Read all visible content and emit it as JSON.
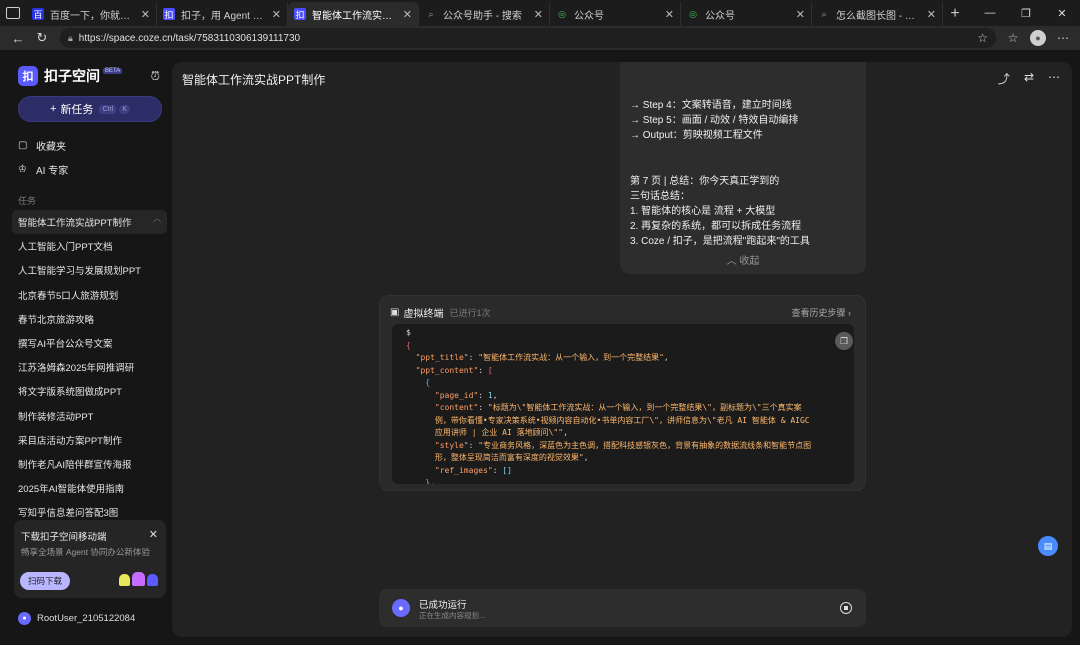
{
  "browser": {
    "tabs": [
      {
        "label": "百度一下，你就知道",
        "icon": "baidu-icon"
      },
      {
        "label": "扣子，用 Agent 重塑生产力",
        "icon": "coze-icon"
      },
      {
        "label": "智能体工作流实战PPT制作 ·",
        "icon": "coze-icon",
        "active": true
      },
      {
        "label": "公众号助手 - 搜索",
        "icon": "search-icon"
      },
      {
        "label": "公众号",
        "icon": "wechat-icon"
      },
      {
        "label": "公众号",
        "icon": "wechat-icon"
      },
      {
        "label": "怎么截图长图 - 搜索",
        "icon": "search-icon"
      }
    ],
    "url": "https://space.coze.cn/task/7583110306139111730"
  },
  "sidebar": {
    "brand": "扣子空间",
    "beta": "BETA",
    "new_task": "新任务",
    "favorites": "收藏夹",
    "ai_expert": "AI 专家",
    "section_tasks": "任务",
    "tasks": [
      "智能体工作流实战PPT制作",
      "人工智能入门PPT文档",
      "人工智能学习与发展规划PPT",
      "北京春节5口人旅游规划",
      "春节北京旅游攻略",
      "撰写AI平台公众号文案",
      "江苏洛姆森2025年网推调研",
      "将文字版系统图做成PPT",
      "制作装修活动PPT",
      "采目店活动方案PPT制作",
      "制作老凡AI陪伴群宣传海报",
      "2025年AI智能体使用指南",
      "写知乎信息差问答配3图"
    ],
    "promo": {
      "title": "下载扣子空间移动端",
      "subtitle": "畅享全场景 Agent 协同办公新体验",
      "button": "扫码下载"
    },
    "user": "RootUser_2105122084"
  },
  "main": {
    "title": "智能体工作流实战PPT制作",
    "message_lines": [
      "→ Step 4：文案转语音，建立时间线",
      "→ Step 5：画面 / 动效 / 特效自动编排",
      "→ Output：剪映视频工程文件",
      "",
      "第 7 页 | 总结：你今天真正学到的",
      "三句话总结：",
      "1. 智能体的核心是 流程 + 大模型",
      "2. 再复杂的系统，都可以拆成任务流程",
      "3. Coze / 扣子，是把流程\"跑起来\"的工具"
    ],
    "collapse": "收起",
    "terminal": {
      "title": "虚拟终端",
      "count": "已进行1次",
      "history": "查看历史步骤",
      "prompt": "$",
      "json_brace": "{",
      "ppt_title_key": "\"ppt_title\"",
      "ppt_title_val": "\"智能体工作流实战：从一个输入，到一个完整结果\"",
      "ppt_content_key": "\"ppt_content\"",
      "page_id_key": "\"page_id\"",
      "page_id_val": "1",
      "content_key": "\"content\"",
      "content_val_1": "\"标题为\\\"智能体工作流实战：从一个输入，到一个完整结果\\\"，副标题为\\\"三个真实案",
      "content_val_2": "例，带你看懂•专家决策系统•视频内容自动化•书单内容工厂\\\"，讲师信息为\\\"老凡 AI 智能体 & AIGC",
      "content_val_3": "应用讲师 | 企业 AI 落地顾问\\\"\"",
      "style_key": "\"style\"",
      "style_val_1": "\"专业商务风格，深蓝色为主色调，搭配科技感银灰色，背景有抽象的数据流线条和智能节点图",
      "style_val_2": "形，整体呈现简洁而富有深度的视觉效果\"",
      "ref_images_key": "\"ref_images\"",
      "ref_images_val": "[]"
    },
    "status": {
      "line1": "已成功运行",
      "line2": "正在生成内容规划..."
    }
  }
}
